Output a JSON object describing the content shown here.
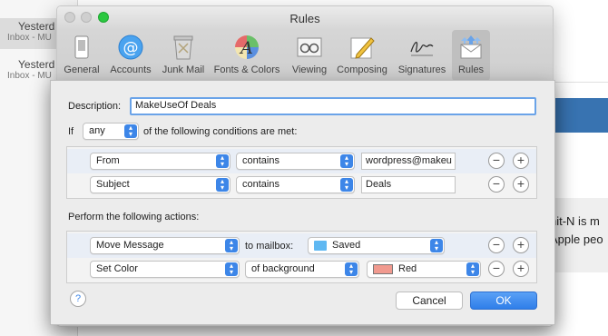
{
  "background": {
    "list": [
      {
        "title": "Yesterd",
        "subtitle": "Inbox - MU"
      },
      {
        "title": "Yesterd",
        "subtitle": "Inbox - MU"
      }
    ],
    "text_lines": [
      "hit-N is m",
      "Apple peo"
    ]
  },
  "window": {
    "title": "Rules",
    "toolbar": [
      {
        "label": "General",
        "icon": "general-icon"
      },
      {
        "label": "Accounts",
        "icon": "accounts-icon"
      },
      {
        "label": "Junk Mail",
        "icon": "junk-mail-icon"
      },
      {
        "label": "Fonts & Colors",
        "icon": "fonts-colors-icon"
      },
      {
        "label": "Viewing",
        "icon": "viewing-icon"
      },
      {
        "label": "Composing",
        "icon": "composing-icon"
      },
      {
        "label": "Signatures",
        "icon": "signatures-icon"
      },
      {
        "label": "Rules",
        "icon": "rules-icon",
        "active": true
      }
    ]
  },
  "sheet": {
    "description_label": "Description:",
    "description_value": "MakeUseOf Deals",
    "if_label": "If",
    "match_selector": "any",
    "conditions_label": "of the following conditions are met:",
    "conditions": [
      {
        "field": "From",
        "operator": "contains",
        "value": "wordpress@makeu"
      },
      {
        "field": "Subject",
        "operator": "contains",
        "value": "Deals"
      }
    ],
    "actions_label": "Perform the following actions:",
    "actions": [
      {
        "action": "Move Message",
        "connector": "to mailbox:",
        "target": "Saved"
      },
      {
        "action": "Set Color",
        "connector": "of background",
        "target": "Red"
      }
    ],
    "help": "?",
    "cancel_label": "Cancel",
    "ok_label": "OK",
    "minus": "−",
    "plus": "+"
  },
  "colors": {
    "accent": "#3d86e8",
    "swatch_red": "#f19a8f",
    "folder": "#5fb8f2"
  }
}
